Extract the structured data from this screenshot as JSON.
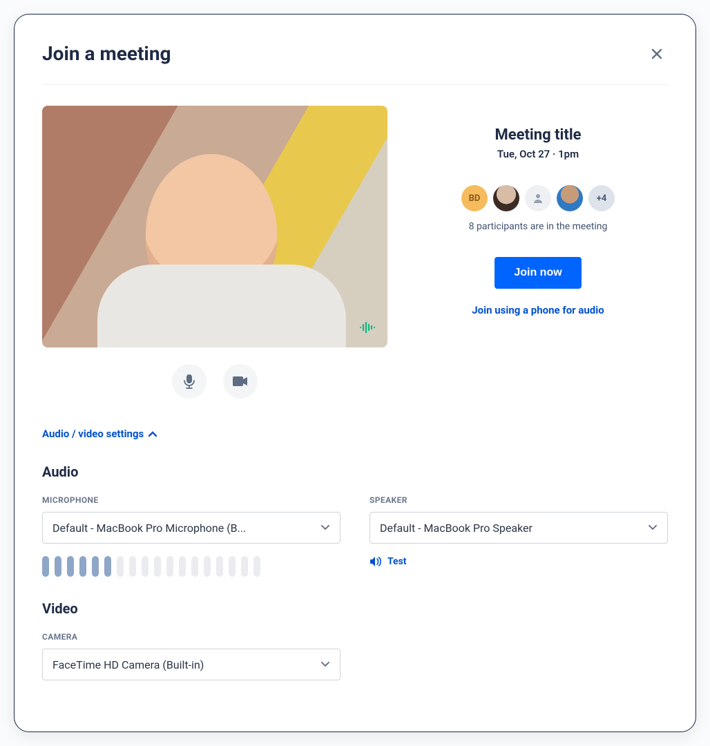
{
  "header": {
    "title": "Join a meeting"
  },
  "meeting": {
    "title": "Meeting title",
    "datetime": "Tue, Oct 27 · 1pm",
    "avatars": {
      "initials": "BD",
      "more": "+4"
    },
    "participants_text": "8 participants are in the meeting",
    "join_button": "Join now",
    "phone_link": "Join using a phone for audio"
  },
  "settings_toggle": "Audio / video settings",
  "audio": {
    "section": "Audio",
    "mic_label": "MICROPHONE",
    "mic_selected": "Default - MacBook Pro Microphone (B...",
    "speaker_label": "SPEAKER",
    "speaker_selected": "Default - MacBook Pro Speaker",
    "test": "Test",
    "level_active_bars": 6,
    "level_total_bars": 18
  },
  "video": {
    "section": "Video",
    "camera_label": "CAMERA",
    "camera_selected": "FaceTime HD Camera (Built-in)"
  }
}
